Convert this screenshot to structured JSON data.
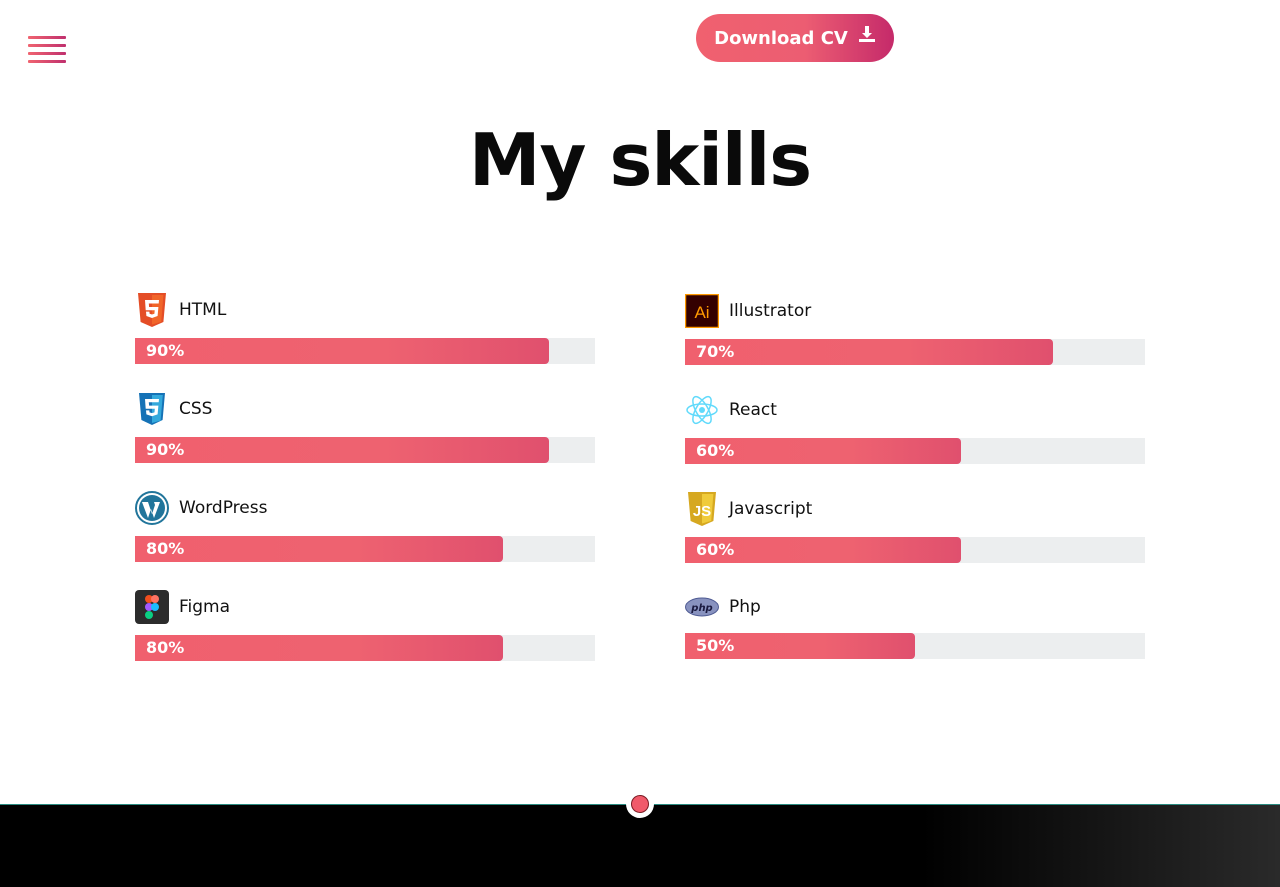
{
  "header": {
    "download_label": "Download CV"
  },
  "section": {
    "title": "My skills"
  },
  "skills": [
    {
      "name": "HTML",
      "level": 90,
      "label": "90%",
      "icon": "html5-icon"
    },
    {
      "name": "CSS",
      "level": 90,
      "label": "90%",
      "icon": "css3-icon"
    },
    {
      "name": "WordPress",
      "level": 80,
      "label": "80%",
      "icon": "wordpress-icon"
    },
    {
      "name": "Figma",
      "level": 80,
      "label": "80%",
      "icon": "figma-icon"
    },
    {
      "name": "Illustrator",
      "level": 80,
      "label": "70%",
      "icon": "illustrator-icon"
    },
    {
      "name": "React",
      "level": 60,
      "label": "60%",
      "icon": "react-icon"
    },
    {
      "name": "Javascript",
      "level": 60,
      "label": "60%",
      "icon": "javascript-icon"
    },
    {
      "name": "Php",
      "level": 50,
      "label": "50%",
      "icon": "php-icon"
    }
  ],
  "colors": {
    "accent": "#f0616f",
    "accent_dark": "#c52a6a",
    "track": "#eceeef"
  }
}
